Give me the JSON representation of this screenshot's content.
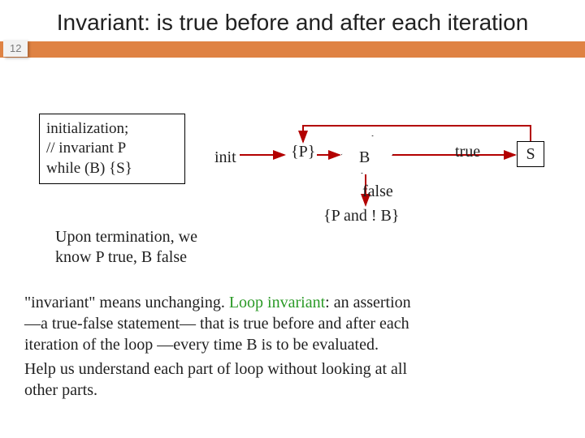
{
  "title": "Invariant: is true before and after each iteration",
  "page_number": "12",
  "codebox": {
    "line1": "initialization;",
    "line2": "// invariant P",
    "line3": " while (B) {S}"
  },
  "flowchart": {
    "init": "init",
    "p": "{P}",
    "b": "B",
    "true": "true",
    "false": "false",
    "s": "S",
    "p_and_not_b": "{P  and ! B}"
  },
  "termination_note": {
    "line1": "Upon termination, we",
    "line2": "know P true, B false"
  },
  "definition": {
    "l1a": "\"invariant\" means unchanging. ",
    "l1b": "Loop invariant",
    "l1c": ": an assertion",
    "l2": "—a true-false statement— that is true before and after each",
    "l3": "iteration of the loop —every time B is to be evaluated.",
    "l4": "Help us understand each part of loop without looking at all",
    "l5": "other parts."
  }
}
